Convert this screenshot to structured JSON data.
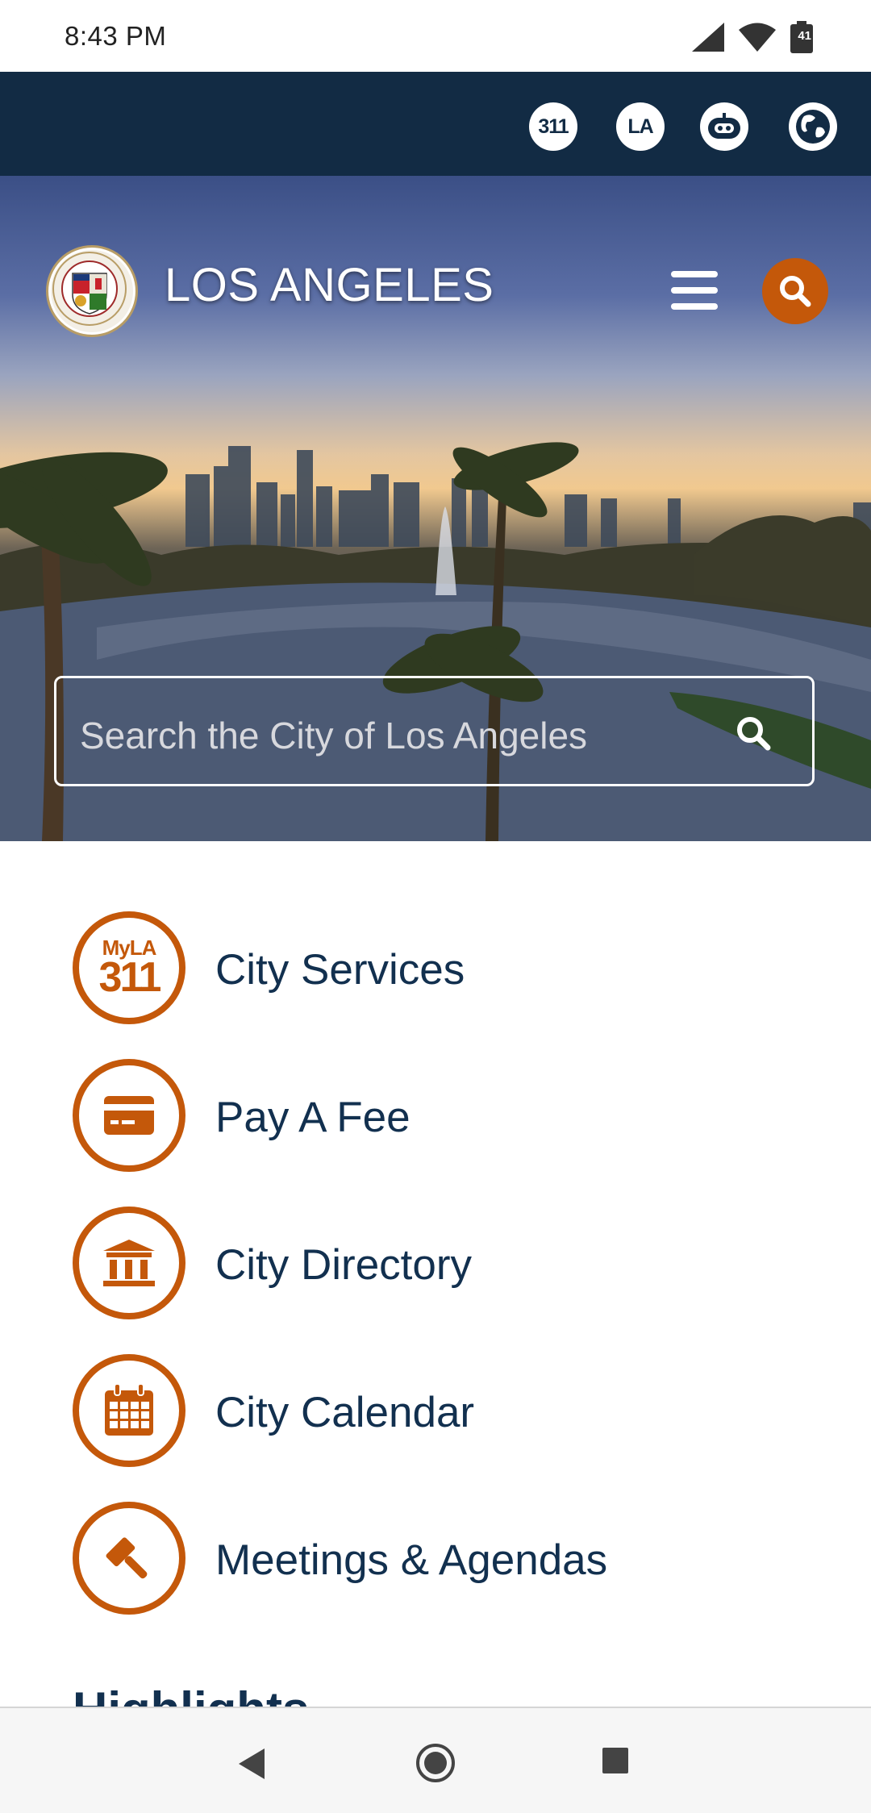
{
  "status_bar": {
    "time": "8:43 PM",
    "battery_level": "41"
  },
  "utility_bar": {
    "buttons": [
      {
        "label": "311",
        "icon": "311-icon"
      },
      {
        "label": "LA",
        "icon": "la-icon"
      },
      {
        "label": "",
        "icon": "chatbot-icon"
      },
      {
        "label": "",
        "icon": "globe-icon"
      }
    ]
  },
  "header": {
    "title": "LOS ANGELES",
    "accent_color": "#c4580a",
    "navy_color": "#122b44"
  },
  "search": {
    "placeholder": "Search the City of Los Angeles"
  },
  "services": {
    "items": [
      {
        "label": "City Services",
        "icon": "myla311-icon",
        "badge_small": "MyLA",
        "badge_big": "311"
      },
      {
        "label": "Pay A Fee",
        "icon": "credit-card-icon"
      },
      {
        "label": "City Directory",
        "icon": "government-building-icon"
      },
      {
        "label": "City Calendar",
        "icon": "calendar-icon"
      },
      {
        "label": "Meetings & Agendas",
        "icon": "gavel-icon"
      }
    ]
  },
  "highlights": {
    "heading": "Highlights"
  }
}
